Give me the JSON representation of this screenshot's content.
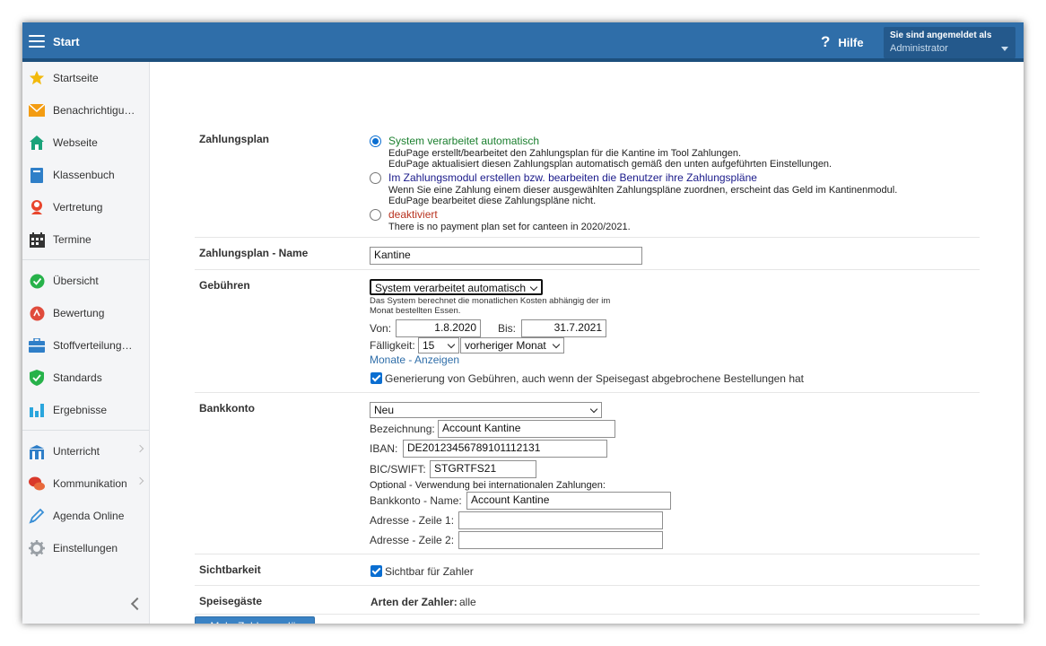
{
  "header": {
    "title": "Start",
    "help_label": "Hilfe",
    "help_icon": "?",
    "user_line1": "Sie sind angemeldet als",
    "user_line2": "Administrator"
  },
  "sidebar": {
    "items": [
      {
        "label": "Startseite",
        "icon": "star-icon"
      },
      {
        "label": "Benachrichtigu…",
        "icon": "envelope-icon"
      },
      {
        "label": "Webseite",
        "icon": "home-icon"
      },
      {
        "label": "Klassenbuch",
        "icon": "book-icon"
      },
      {
        "label": "Vertretung",
        "icon": "person-icon"
      },
      {
        "label": "Termine",
        "icon": "calendar-icon"
      },
      {
        "label": "Übersicht",
        "icon": "check-circle-icon"
      },
      {
        "label": "Bewertung",
        "icon": "grade-icon"
      },
      {
        "label": "Stoffverteilung…",
        "icon": "briefcase-icon"
      },
      {
        "label": "Standards",
        "icon": "shield-icon"
      },
      {
        "label": "Ergebnisse",
        "icon": "bar-chart-icon"
      },
      {
        "label": "Unterricht",
        "icon": "building-icon"
      },
      {
        "label": "Kommunikation",
        "icon": "chat-icon"
      },
      {
        "label": "Agenda Online",
        "icon": "pen-icon"
      },
      {
        "label": "Einstellungen",
        "icon": "gear-icon"
      }
    ]
  },
  "form": {
    "zahlungsplan": {
      "label": "Zahlungsplan",
      "opt1": "System verarbeitet automatisch",
      "opt1_desc1": "EduPage erstellt/bearbeitet den Zahlungsplan für die Kantine im Tool Zahlungen.",
      "opt1_desc2": "EduPage aktualisiert diesen Zahlungsplan automatisch gemäß den unten aufgeführten Einstellungen.",
      "opt2": "Im Zahlungsmodul erstellen bzw. bearbeiten die Benutzer ihre Zahlungspläne",
      "opt2_desc1": "Wenn Sie eine Zahlung einem dieser ausgewählten Zahlungspläne zuordnen, erscheint das Geld im Kantinenmodul.",
      "opt2_desc2": "EduPage bearbeitet diese Zahlungspläne nicht.",
      "opt3": "deaktiviert",
      "opt3_desc": "There is no payment plan set for canteen in 2020/2021.",
      "colors": {
        "opt1": "#1a7f2e",
        "opt2": "#1a1a8a",
        "opt3": "#b8321f"
      }
    },
    "name": {
      "label": "Zahlungsplan - Name",
      "value": "Kantine"
    },
    "gebuehren": {
      "label": "Gebühren",
      "select_value": "System verarbeitet automatisch",
      "desc1": "Das System berechnet die monatlichen Kosten abhängig der im",
      "desc2": "Monat bestellten Essen.",
      "von_label": "Von:",
      "von_value": "1.8.2020",
      "bis_label": "Bis:",
      "bis_value": "31.7.2021",
      "faelligkeit_label": "Fälligkeit:",
      "faelligkeit_day": "15",
      "faelligkeit_month": "vorheriger Monat",
      "monate_link": "Monate - Anzeigen",
      "generate_checkbox": "Generierung von Gebühren, auch wenn der Speisegast abgebrochene Bestellungen hat"
    },
    "bankkonto": {
      "label": "Bankkonto",
      "select_value": "Neu",
      "bezeichnung_label": "Bezeichnung:",
      "bezeichnung_value": "Account Kantine",
      "iban_label": "IBAN:",
      "iban_value": "DE20123456789101112131",
      "bic_label": "BIC/SWIFT:",
      "bic_value": "STGRTFS21",
      "optional_note": "Optional - Verwendung bei internationalen Zahlungen:",
      "kontoname_label": "Bankkonto - Name:",
      "kontoname_value": "Account Kantine",
      "adresse1_label": "Adresse - Zeile 1:",
      "adresse1_value": "",
      "adresse2_label": "Adresse - Zeile 2:",
      "adresse2_value": ""
    },
    "sichtbarkeit": {
      "label": "Sichtbarkeit",
      "checkbox": "Sichtbar für Zahler"
    },
    "speisegaeste": {
      "label": "Speisegäste",
      "arten_label": "Arten der Zahler:",
      "arten_value": "alle"
    },
    "more_button": "+ Mehr Zahlungspläne"
  }
}
